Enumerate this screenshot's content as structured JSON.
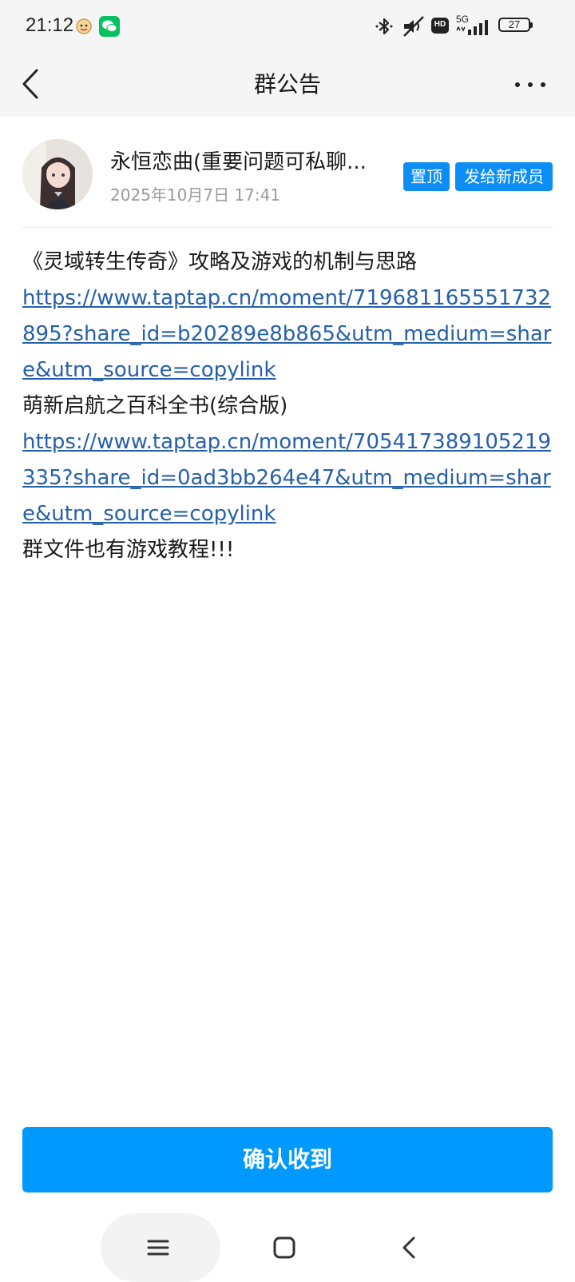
{
  "status_bar": {
    "time": "21:12",
    "battery": "27",
    "icons": [
      "qq-face-icon",
      "wechat-icon",
      "bluetooth-icon",
      "mute-icon",
      "hd-icon",
      "5g-signal-icon",
      "battery-icon"
    ],
    "wechat_color": "#07c160",
    "hd_label": "HD",
    "network_label": "5G"
  },
  "header": {
    "title": "群公告",
    "back_icon": "chevron-left-icon",
    "more_icon": "more-horizontal-icon"
  },
  "announcement": {
    "author": "永恒恋曲(重要问题可私聊...",
    "time": "2025年10月7日 17:41",
    "tags": [
      "置顶",
      "发给新成员"
    ],
    "tag_color": "#0d8ef6",
    "link_color": "#2660ab",
    "lines": [
      {
        "type": "text",
        "text": "《灵域转生传奇》攻略及游戏的机制与思路"
      },
      {
        "type": "link",
        "text": "https://www.taptap.cn/moment/719681165551732895?share_id=b20289e8b865&utm_medium=share&utm_source=copylink"
      },
      {
        "type": "text",
        "text": "萌新启航之百科全书(综合版)"
      },
      {
        "type": "link",
        "text": "https://www.taptap.cn/moment/705417389105219335?share_id=0ad3bb264e47&utm_medium=share&utm_source=copylink"
      },
      {
        "type": "text",
        "text": "群文件也有游戏教程!!!"
      }
    ]
  },
  "confirm": {
    "label": "确认收到",
    "color": "#0099ff"
  },
  "nav_bar": {
    "icons": [
      "menu-icon",
      "home-square-icon",
      "back-chevron-icon"
    ]
  }
}
